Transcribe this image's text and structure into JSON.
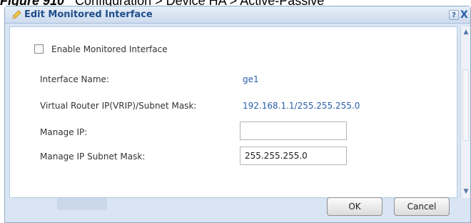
{
  "figure": {
    "prefix": "Figure 910",
    "caption": "Configuration > Device HA > Active-Passive"
  },
  "dialog": {
    "title": "Edit Monitored Interface",
    "help_glyph": "?",
    "close_glyph": "X"
  },
  "form": {
    "enable_label": "Enable Monitored Interface",
    "enable_checked": false,
    "interface_name_label": "Interface Name:",
    "interface_name_value": "ge1",
    "vrip_label": "Virtual Router IP(VRIP)/Subnet Mask:",
    "vrip_value": "192.168.1.1/255.255.255.0",
    "manage_ip_label": "Manage IP:",
    "manage_ip_value": "",
    "manage_ip_mask_label": "Manage IP Subnet Mask:",
    "manage_ip_mask_value": "255.255.255.0"
  },
  "buttons": {
    "ok_label": "OK",
    "cancel_label": "Cancel"
  },
  "icons": {
    "title_icon": "edit-pencil-icon",
    "scroll_up": "chevron-up-icon",
    "scroll_down": "chevron-down-icon"
  },
  "colors": {
    "dialog_bg": "#d9e5f3",
    "title_text": "#1f4e8c",
    "link_text": "#2a5da8"
  }
}
